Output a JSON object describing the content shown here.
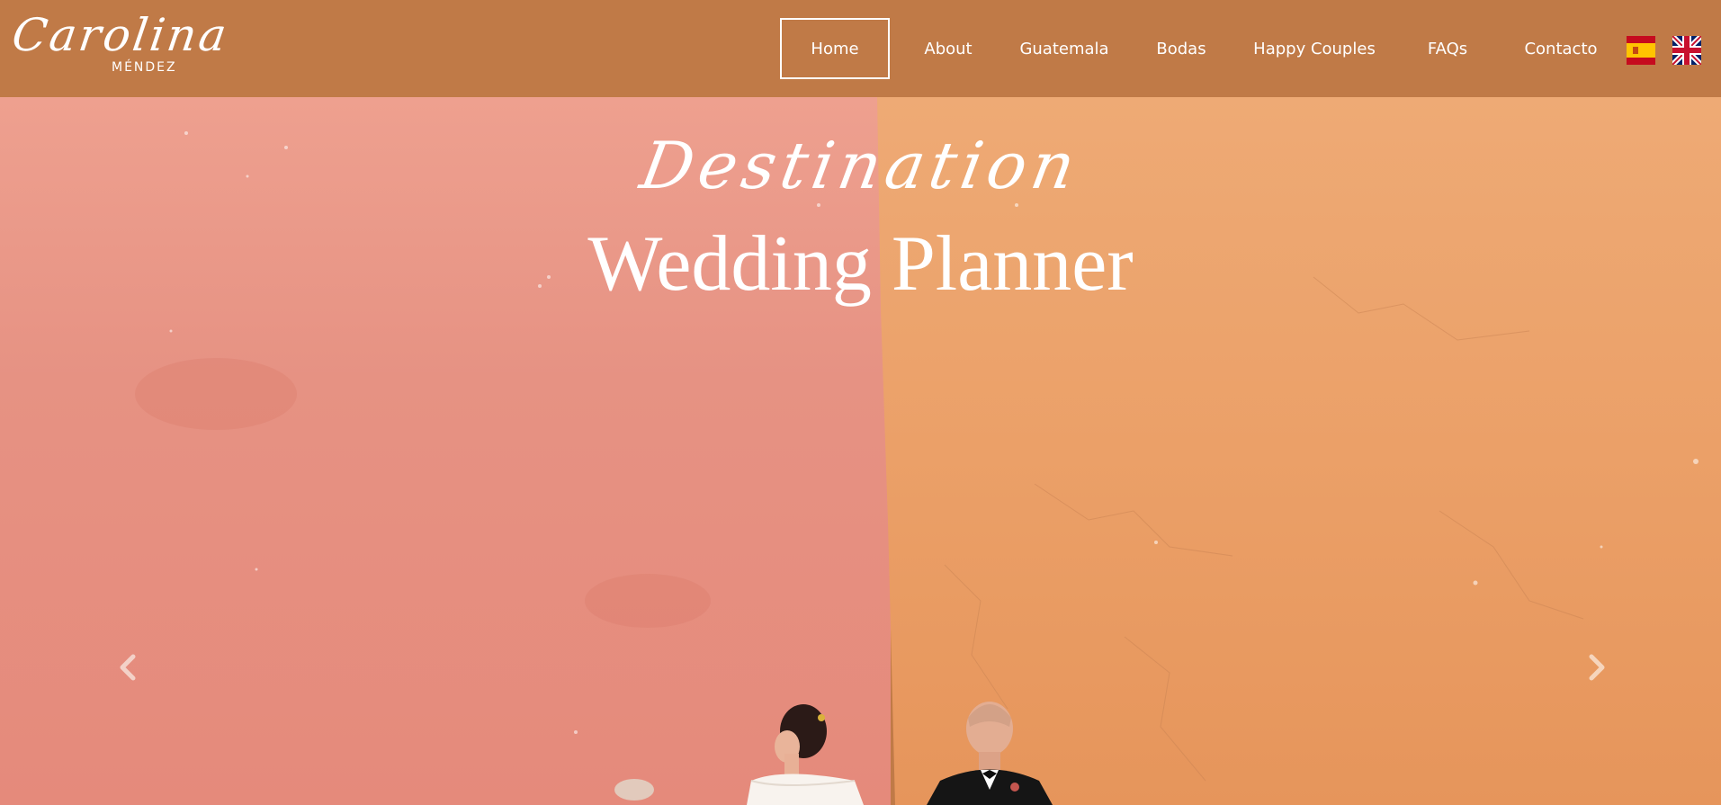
{
  "brand": {
    "name": "Carolina",
    "surname": "MÉNDEZ"
  },
  "nav": {
    "items": [
      {
        "label": "Home",
        "active": true
      },
      {
        "label": "About"
      },
      {
        "label": "Guatemala"
      },
      {
        "label": "Bodas"
      },
      {
        "label": "Happy Couples"
      },
      {
        "label": "FAQs"
      },
      {
        "label": "Contacto"
      }
    ],
    "languages": [
      "spain-flag-icon",
      "uk-flag-icon"
    ]
  },
  "hero": {
    "script_line": "Destination",
    "main_line": "Wedding Planner",
    "prev_icon": "chevron-left-icon",
    "next_icon": "chevron-right-icon"
  },
  "colors": {
    "header_bg": "#c07a47",
    "wall_left": "#e69283",
    "wall_right": "#eba068",
    "text": "#ffffff"
  }
}
